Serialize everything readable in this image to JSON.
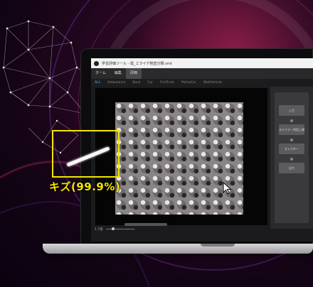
{
  "window": {
    "title": "学習評価ツール - 傷_エライデ検査分類.vmt"
  },
  "menu": {
    "items": [
      "ホーム",
      "編集",
      "評価"
    ],
    "active_index": 2
  },
  "tabs": {
    "items": [
      "ALL",
      "Ambulance",
      "Back",
      "Car",
      "FireTruck",
      "PoliceCar",
      "WaitVehicle"
    ],
    "active_index": 0
  },
  "detection": {
    "label": "キズ(99.9%)",
    "box_color": "#f2e600"
  },
  "status": {
    "zoom": "1.7倍"
  },
  "side_panel": {
    "buttons": [
      "入力",
      "ステイデー判定上値",
      "セレクター",
      "出力"
    ]
  },
  "colors": {
    "accent_tab": "#5fb8ff",
    "label_yellow": "#f5e400"
  }
}
